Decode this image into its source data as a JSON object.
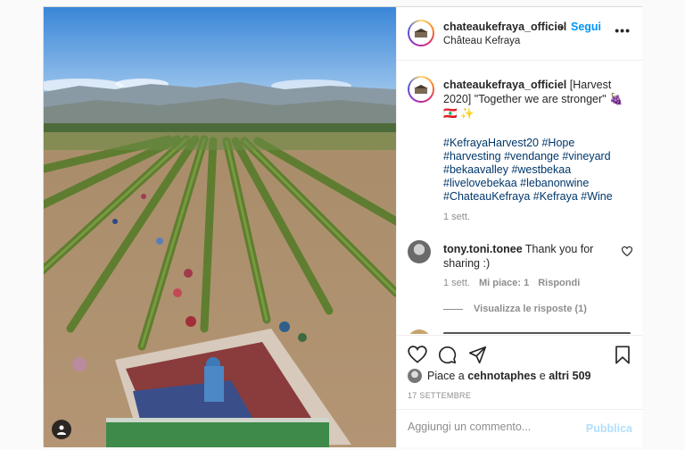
{
  "post": {
    "username": "chateaukefraya_officiel",
    "follow_sep": "•",
    "follow_label": "Segui",
    "location": "Château Kefraya",
    "more_label": "•••"
  },
  "caption": {
    "username": "chateaukefraya_officiel",
    "text": "[Harvest 2020] \"Together we are stronger\" 🍇 🇱🇧 ✨",
    "hashtags": "#KefrayaHarvest20 #Hope #harvesting #vendange #vineyard #bekaavalley #westbekaa #livelovebekaa #lebanonwine #ChateauKefraya #Kefraya #Wine",
    "time": "1 sett."
  },
  "comment": {
    "username": "tony.toni.tonee",
    "text": "Thank you for sharing :)",
    "time": "1 sett.",
    "likes": "Mi piace: 1",
    "reply": "Rispondi",
    "view_replies": "Visualizza le risposte (1)"
  },
  "likes": {
    "prefix": "Piace a",
    "user": "cehnotaphes",
    "middle": "e",
    "others": "altri 509"
  },
  "date": "17 SETTEMBRE",
  "add_comment": {
    "placeholder": "Aggiungi un commento...",
    "publish_label": "Pubblica"
  },
  "icons": {
    "like": "heart-icon",
    "comment": "comment-icon",
    "share": "send-icon",
    "save": "bookmark-icon",
    "tagged": "user-tag-icon",
    "more": "more-icon"
  },
  "colors": {
    "link_blue": "#0095f6",
    "hashtag_blue": "#00376b",
    "muted": "#8e8e8e",
    "publish_disabled": "#b2dffc"
  }
}
